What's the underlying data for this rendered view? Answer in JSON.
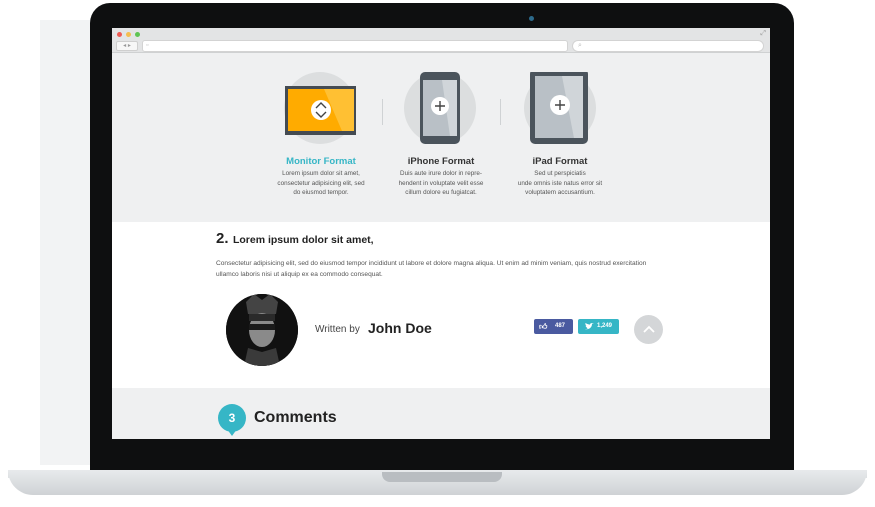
{
  "colors": {
    "accent": "#36b6c6",
    "facebook": "#4a5aa0",
    "twitter": "#36b6c6",
    "monitor": "#ffab00"
  },
  "browser": {
    "nav_glyph": "◂ ▸",
    "url": "",
    "search": ""
  },
  "formats": [
    {
      "icon": "monitor-icon",
      "title": "Monitor Format",
      "description": "Lorem ipsum dolor sit amet,\nconsectetur adipisicing elit, sed\ndo eiusmod tempor."
    },
    {
      "icon": "iphone-icon",
      "title": "iPhone Format",
      "description": "Duis aute irure dolor in repre-\nhendent in voluptate velit esse\ncillum dolore eu fugiatcat."
    },
    {
      "icon": "ipad-icon",
      "title": "iPad Format",
      "description": "Sed ut perspiciatis\nunde omnis iste natus error sit\nvoluptatem accusantium."
    }
  ],
  "article": {
    "number": "2.",
    "title": "Lorem ipsum dolor sit amet,",
    "body": "Consectetur adipisicing elit, sed do eiusmod tempor incididunt ut labore et dolore magna aliqua. Ut enim ad minim veniam, quis nostrud exercitation ullamco laboris nisi ut aliquip ex ea commodo consequat.",
    "written_by": "Written by",
    "author": "John Doe",
    "likes": "487",
    "tweets": "1,249"
  },
  "comments": {
    "count": "3",
    "title": "Comments"
  }
}
